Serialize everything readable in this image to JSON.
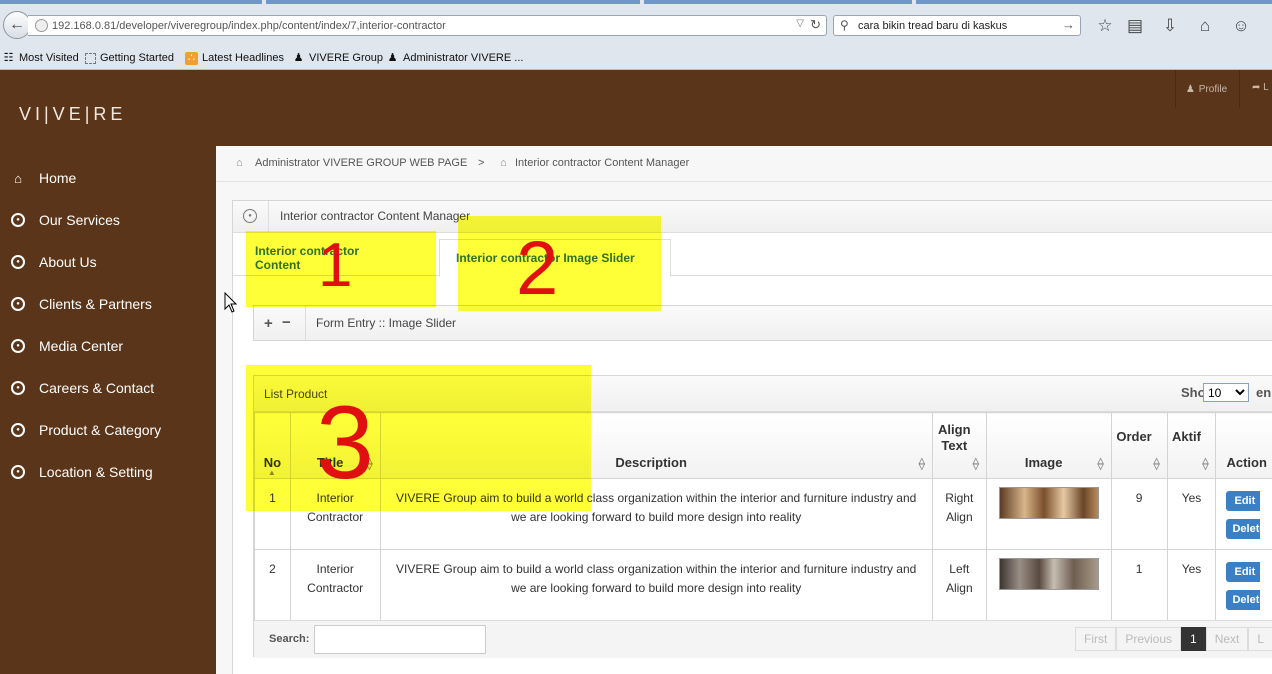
{
  "browser": {
    "url": "192.168.0.81/developer/viveregroup/index.php/content/index/7,interior-contractor",
    "search_value": "cara bikin tread baru di kaskus",
    "bookmarks": [
      {
        "label": "Most Visited",
        "icon": "most-visited-icon"
      },
      {
        "label": "Getting Started",
        "icon": "page-icon"
      },
      {
        "label": "Latest Headlines",
        "icon": "rss-icon"
      },
      {
        "label": "VIVERE Group",
        "icon": "linux-icon"
      },
      {
        "label": "Administrator VIVERE ...",
        "icon": "linux-icon"
      }
    ]
  },
  "header": {
    "logo": "VI|VE|RE",
    "profile_label": "Profile",
    "logout_label": "L"
  },
  "sidebar": {
    "items": [
      {
        "label": "Home",
        "icon": "home-icon"
      },
      {
        "label": "Our Services",
        "icon": "circle-dot-icon"
      },
      {
        "label": "About Us",
        "icon": "circle-dot-icon"
      },
      {
        "label": "Clients & Partners",
        "icon": "circle-dot-icon"
      },
      {
        "label": "Media Center",
        "icon": "circle-dot-icon"
      },
      {
        "label": "Careers & Contact",
        "icon": "circle-dot-icon"
      },
      {
        "label": "Product & Category",
        "icon": "circle-dot-icon"
      },
      {
        "label": "Location & Setting",
        "icon": "circle-dot-icon"
      }
    ]
  },
  "breadcrumb": {
    "item1": "Administrator VIVERE GROUP WEB PAGE",
    "separator": ">",
    "item2": "Interior contractor Content Manager"
  },
  "box": {
    "title": "Interior contractor Content Manager",
    "tabs": [
      {
        "label": "Interior contractor Content"
      },
      {
        "label": "Interior contractor Image Slider"
      }
    ],
    "form_entry_title": "Form Entry :: Image Slider"
  },
  "list": {
    "title": "List Product",
    "show_label": "Show",
    "show_value": "10",
    "entries_label": "en",
    "columns": [
      "No",
      "Title",
      "Description",
      "Align Text",
      "Image",
      "Order",
      "Aktif",
      "Action"
    ],
    "rows": [
      {
        "no": "1",
        "title": "Interior Contractor",
        "description": "VIVERE Group aim to build a world class organization within the interior and furniture industry and we are looking forward to build more design into reality",
        "align": "Right Align",
        "order": "9",
        "aktif": "Yes",
        "edit_label": "Edit",
        "delete_label": "Delete"
      },
      {
        "no": "2",
        "title": "Interior Contractor",
        "description": "VIVERE Group aim to build a world class organization within the interior and furniture industry and we are looking forward to build more design into reality",
        "align": "Left Align",
        "order": "1",
        "aktif": "Yes",
        "edit_label": "Edit",
        "delete_label": "Delete"
      }
    ],
    "search_label": "Search:",
    "pager": {
      "first": "First",
      "previous": "Previous",
      "current": "1",
      "next": "Next",
      "last": "L"
    }
  },
  "annotations": {
    "numbers": [
      "1",
      "2",
      "3"
    ],
    "highlight_color": "#ffff00",
    "ink_color": "#e01010"
  }
}
